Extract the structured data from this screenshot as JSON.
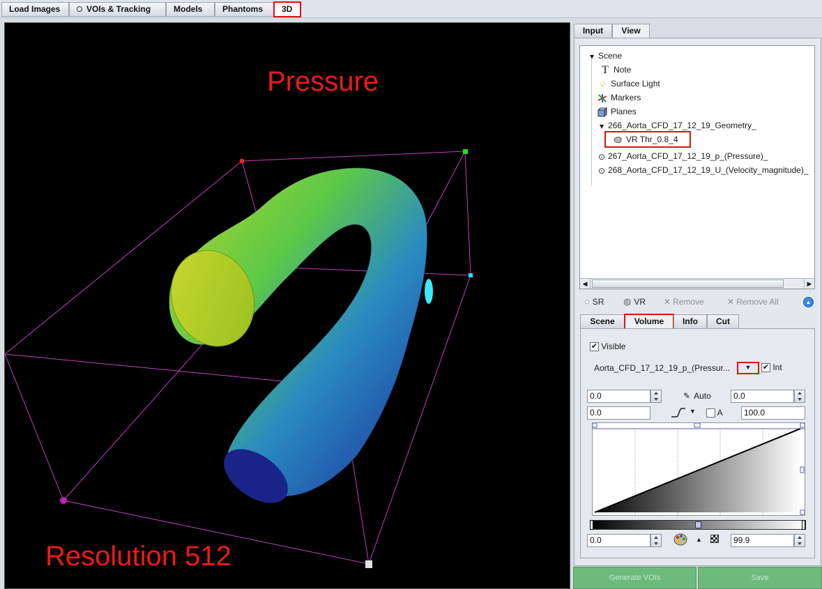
{
  "top_tabs": [
    {
      "label": "Load Images"
    },
    {
      "label": "VOIs & Tracking"
    },
    {
      "label": "Models"
    },
    {
      "label": "Phantoms"
    },
    {
      "label": "3D"
    }
  ],
  "viewport": {
    "overlay_title": "Pressure",
    "overlay_resolution": "Resolution 512"
  },
  "panel_tabs": [
    {
      "label": "Input"
    },
    {
      "label": "View"
    }
  ],
  "tree": {
    "root": "Scene",
    "items": [
      {
        "label": "Note",
        "icon": "text-T-icon"
      },
      {
        "label": "Surface Light",
        "icon": "lightbulb-icon"
      },
      {
        "label": "Markers",
        "icon": "axes-icon"
      },
      {
        "label": "Planes",
        "icon": "cube-planes-icon"
      },
      {
        "label": "266_Aorta_CFD_17_12_19_Geometry_",
        "icon": "expand-triangle-icon"
      },
      {
        "label": "VR Thr_0.8_4",
        "icon": "volume-render-icon"
      },
      {
        "label": "267_Aorta_CFD_17_12_19_p_(Pressure)_",
        "icon": "radio-dot-icon"
      },
      {
        "label": "268_Aorta_CFD_17_12_19_U_(Velocity_magnitude)_",
        "icon": "radio-dot-icon"
      }
    ]
  },
  "toolbar": {
    "sr_label": "SR",
    "vr_label": "VR",
    "remove_label": "Remove",
    "remove_all_label": "Remove All"
  },
  "sub_tabs": [
    {
      "label": "Scene"
    },
    {
      "label": "Volume"
    },
    {
      "label": "Info"
    },
    {
      "label": "Cut"
    }
  ],
  "volume": {
    "visible_label": "Visible",
    "series_label": "Aorta_CFD_17_12_19_p_(Pressur...",
    "int_label": "Int",
    "auto_label": "Auto",
    "a_label": "A",
    "field_min": "0.0",
    "field_max": "0.0",
    "field_low": "0.0",
    "field_high": "100.0",
    "lut_min": "0.0",
    "lut_max": "99.9"
  },
  "bottom_buttons": {
    "left_label": "Generate VOIs",
    "right_label": "Save"
  },
  "colors": {
    "highlight": "#e01010",
    "overlay_text": "#f01818",
    "bbox_line": "#c040c0"
  }
}
